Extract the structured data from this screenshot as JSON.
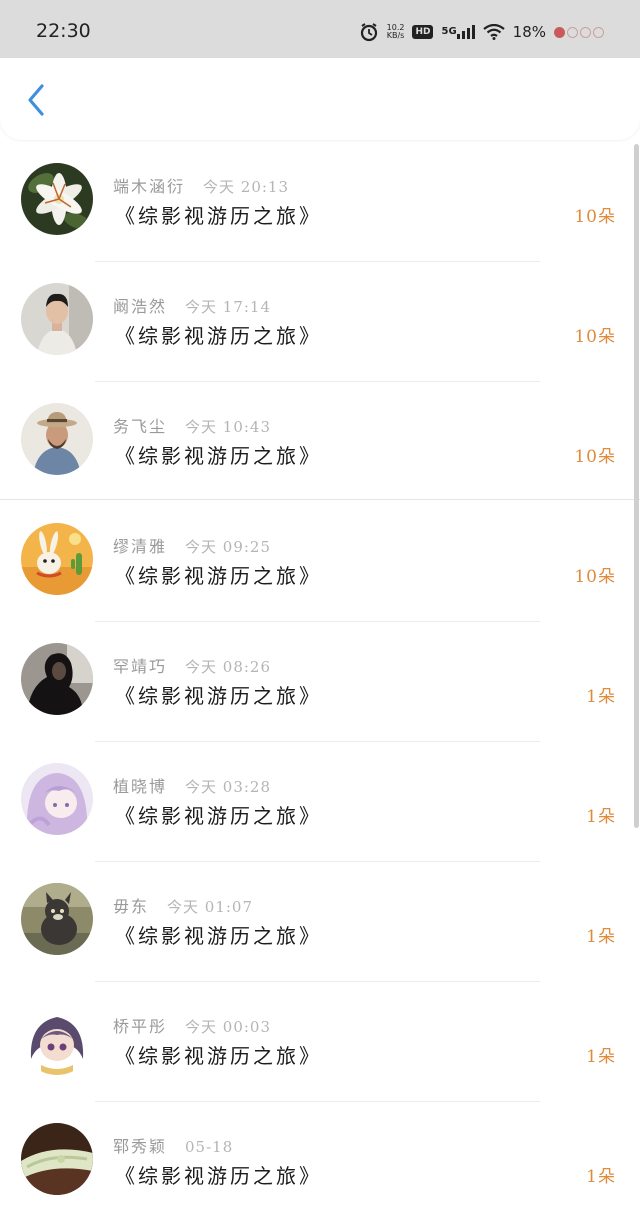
{
  "status_bar": {
    "time": "22:30",
    "net_speed_value": "10.2",
    "net_speed_unit": "KB/s",
    "hd_label": "HD",
    "network_label": "5G",
    "battery_percent": "18%"
  },
  "nav": {
    "back_icon": "chevron-left-icon",
    "accent_color": "#3d8fe0"
  },
  "colors": {
    "gift_count": "#e08a3c",
    "name": "#9a9a9a",
    "time": "#b5b5b5",
    "title": "#1c1c1c"
  },
  "gifts": [
    {
      "name": "端木涵衍",
      "time": "今天 20:13",
      "title": "《综影视游历之旅》",
      "count": "10朵",
      "avatar": "lily-flower"
    },
    {
      "name": "阚浩然",
      "time": "今天 17:14",
      "title": "《综影视游历之旅》",
      "count": "10朵",
      "avatar": "young-man"
    },
    {
      "name": "务飞尘",
      "time": "今天 10:43",
      "title": "《综影视游历之旅》",
      "count": "10朵",
      "avatar": "man-with-hat"
    },
    {
      "name": "缪清雅",
      "time": "今天 09:25",
      "title": "《综影视游历之旅》",
      "count": "10朵",
      "avatar": "cartoon-rabbit-desert"
    },
    {
      "name": "罕靖巧",
      "time": "今天 08:26",
      "title": "《综影视游历之旅》",
      "count": "1朵",
      "avatar": "dark-hair-girl"
    },
    {
      "name": "植晓博",
      "time": "今天 03:28",
      "title": "《综影视游历之旅》",
      "count": "1朵",
      "avatar": "anime-girl-lavender"
    },
    {
      "name": "毋东",
      "time": "今天 01:07",
      "title": "《综影视游历之旅》",
      "count": "1朵",
      "avatar": "cartoon-cat"
    },
    {
      "name": "桥平彤",
      "time": "今天 00:03",
      "title": "《综影视游历之旅》",
      "count": "1朵",
      "avatar": "anime-chibi-girl"
    },
    {
      "name": "郓秀颖",
      "time": "05-18",
      "title": "《综影视游历之旅》",
      "count": "1朵",
      "avatar": "jade-bracelet"
    }
  ]
}
